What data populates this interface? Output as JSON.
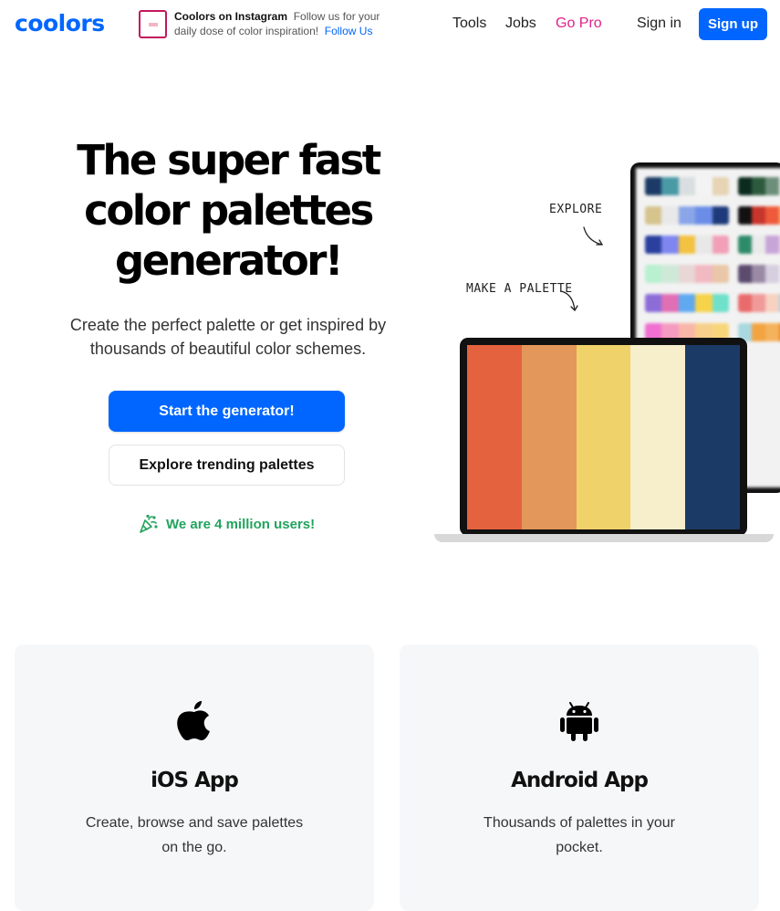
{
  "header": {
    "logo": "coolors",
    "promo": {
      "title": "Coolors on Instagram",
      "text": "Follow us for your daily dose of color inspiration!",
      "link": "Follow Us"
    },
    "nav": [
      "Tools",
      "Jobs",
      "Go Pro"
    ],
    "signin": "Sign in",
    "signup": "Sign up"
  },
  "hero": {
    "title_lines": [
      "The super fast",
      "color palettes",
      "generator!"
    ],
    "subtitle_lines": [
      "Create the perfect palette or get inspired by",
      "thousands of beautiful color schemes."
    ],
    "primary_button": "Start the generator!",
    "secondary_button": "Explore trending palettes",
    "users": "We are 4 million users!"
  },
  "illustration": {
    "explore_label": "EXPLORE",
    "make_label": "MAKE A PALETTE",
    "laptop_palette": [
      "#e5623f",
      "#e4975a",
      "#f0d26b",
      "#f7eecb",
      "#1c3a66"
    ],
    "tablet_rows": [
      [
        [
          "#1c3a66",
          "#4a9aa6",
          "#d9dee0",
          "#f3f3f3",
          "#e6d4b5"
        ],
        [
          "#0c2b1f",
          "#2d5a3d",
          "#6d8f7a",
          "#e8e8e8"
        ]
      ],
      [
        [
          "#d6c48d",
          "#e9e9e9",
          "#8aa6e8",
          "#6b8de8",
          "#1e3a7a"
        ],
        [
          "#111111",
          "#c8352b",
          "#ef5a3c",
          "#f7b26b"
        ]
      ],
      [
        [
          "#2a3f9e",
          "#7f86ef",
          "#f3c241",
          "#e8e8e8",
          "#f1a0b8"
        ],
        [
          "#2e8b6a",
          "#eaeaea",
          "#c8a5d9",
          "#f1d4e3"
        ]
      ],
      [
        [
          "#b8f0d0",
          "#cfe9d9",
          "#e9d6d6",
          "#f1b9c1",
          "#e9c7a8"
        ],
        [
          "#5c4b6e",
          "#9a8aa6",
          "#d6cfe0",
          "#f0edf4"
        ]
      ],
      [
        [
          "#8b6cd9",
          "#e06fb6",
          "#5ea9f0",
          "#f7d34a",
          "#6fe0c9"
        ],
        [
          "#e96b6b",
          "#f19a9a",
          "#f7d1c1",
          "#a9d4e6"
        ]
      ],
      [
        [
          "#f06fd1",
          "#f59ac0",
          "#f7b6a8",
          "#f7cf8a",
          "#f7d67a"
        ],
        [
          "#a9d8e0",
          "#f2a441",
          "#f5b25c",
          "#e88c2c"
        ]
      ]
    ]
  },
  "apps": [
    {
      "icon": "apple-icon",
      "title": "iOS App",
      "desc_lines": [
        "Create, browse and save palettes",
        "on the go."
      ]
    },
    {
      "icon": "android-icon",
      "title": "Android App",
      "desc_lines": [
        "Thousands of palettes in your",
        "pocket."
      ]
    }
  ]
}
